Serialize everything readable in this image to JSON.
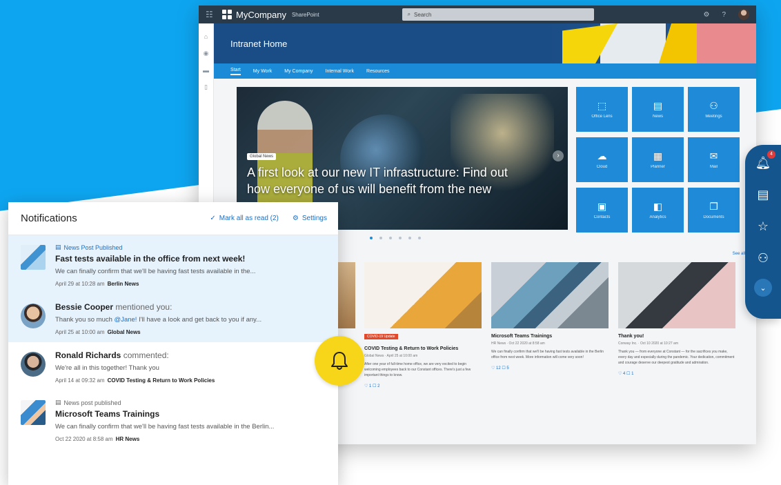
{
  "brand": {
    "name": "MyCompany",
    "sub": "SharePoint"
  },
  "topbar": {
    "search_placeholder": "Search"
  },
  "site": {
    "title": "Intranet Home"
  },
  "nav": [
    "Start",
    "My Work",
    "My Company",
    "Internal Work",
    "Resources"
  ],
  "hero": {
    "tag": "Global News",
    "headline": "A first look at our new IT infrastructure: Find out how everyone of us will benefit from the new space."
  },
  "tiles": [
    {
      "icon": "office-icon",
      "glyph": "⬚",
      "label": "Office Lens"
    },
    {
      "icon": "news-icon",
      "glyph": "▤",
      "label": "News"
    },
    {
      "icon": "meetings-icon",
      "glyph": "⚇",
      "label": "Meetings"
    },
    {
      "icon": "cloud-icon",
      "glyph": "☁",
      "label": "Cloud"
    },
    {
      "icon": "planner-icon",
      "glyph": "▦",
      "label": "Planner"
    },
    {
      "icon": "mail-icon",
      "glyph": "✉",
      "label": "Mail"
    },
    {
      "icon": "contacts-icon",
      "glyph": "▣",
      "label": "Contacts"
    },
    {
      "icon": "analytics-icon",
      "glyph": "◧",
      "label": "Analytics"
    },
    {
      "icon": "documents-icon",
      "glyph": "❐",
      "label": "Documents"
    }
  ],
  "see_all": "See all",
  "cards": [
    {
      "badge": "COVID-19 Update",
      "title": "COVID Testing & Return to Work Policies",
      "meta": "Global News · April 25 at 10:00 am",
      "excerpt": "After one year of full-time home office, we are very excited to begin welcoming employees back to our Constant offices. There's just a few important things to know.",
      "stats": "♡ 1   ☐ 2"
    },
    {
      "badge": "",
      "title": "Microsoft Teams Trainings",
      "meta": "HR News · Oct 22 2020 at 8:58 am",
      "excerpt": "We can finally confirm that we'll be having fast tests available in the Berlin office from next week. More information will come very soon!",
      "stats": "♡ 12   ☐ 5"
    },
    {
      "badge": "",
      "title": "Thank you!",
      "meta": "Conway Inc. · Oct 10 2020 at 10:27 am",
      "excerpt": "Thank you — from everyone at Constant — for the sacrifices you make, every day and especially during the pandemic. Your dedication, commitment and courage deserve our deepest gratitude and admiration.",
      "stats": "♡ 4   ☐ 1"
    }
  ],
  "notifications": {
    "title": "Notifications",
    "mark_all_label": "Mark all as read (2)",
    "settings_label": "Settings",
    "items": [
      {
        "category": "News Post Published",
        "title": "Fast tests available in the office from next week!",
        "text": "We can finally confirm that we'll be having fast tests available in the...",
        "time": "April 29 at 10:28 am",
        "source": "Berlin News"
      },
      {
        "name": "Bessie Cooper",
        "action": " mentioned you:",
        "text_pre": "Thank you so much ",
        "mention": "@Jane!",
        "text_post": " I'll have a look and get back to you if any...",
        "time": "April 25 at 10:00 am",
        "source": "Global News"
      },
      {
        "name": "Ronald Richards",
        "action": " commented:",
        "text": "We're all in this together! Thank you",
        "time": "April 14 at 09:32 am",
        "source": "COVID Testing & Return to Work Policies"
      },
      {
        "category": "News post published",
        "title": "Microsoft Teams Trainings",
        "text": "We can finally confirm that we'll be having fast tests available in the Berlin...",
        "time": "Oct 22 2020 at 8:58 am",
        "source": "HR News"
      }
    ]
  },
  "rightbar": {
    "unread_count": "4"
  },
  "colors": {
    "accent": "#1b8ad7",
    "brand_dark": "#13558c",
    "bell": "#f7d61a",
    "unread_bg": "#e6f2fc"
  }
}
